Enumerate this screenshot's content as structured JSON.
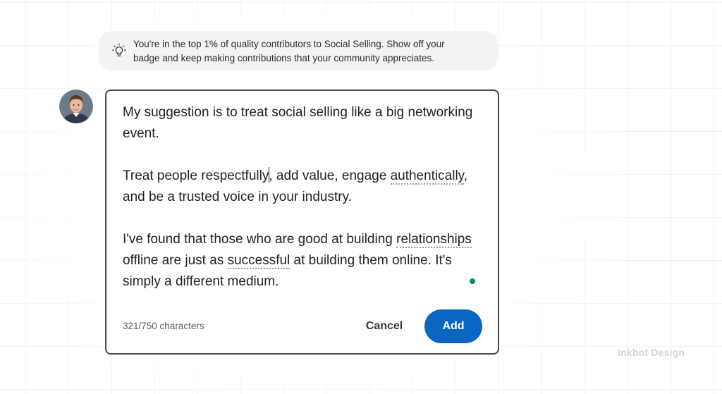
{
  "banner": {
    "icon": "lightbulb-icon",
    "line1": "You're in the top 1% of quality contributors to Social Selling. Show off your",
    "line2": "badge and keep making contributions that your community appreciates."
  },
  "composer": {
    "paragraphs": [
      {
        "segments": [
          "My suggestion is to treat social selling like a big networking event."
        ]
      },
      {
        "segments": [
          "Treat people respectfully",
          ", add value, engage ",
          "authentically",
          ", and be a trusted voice in your industry."
        ]
      },
      {
        "segments": [
          "I've found that those who are good at building ",
          "relationships",
          " offline are just as ",
          "successful",
          " at building them online. It's simply a different medium."
        ]
      }
    ],
    "char_count": "321/750 characters",
    "cancel_label": "Cancel",
    "add_label": "Add",
    "accent_color": "#0a66c2",
    "status_dot_color": "#0a8a6a"
  },
  "watermark": "Inkbot Design"
}
